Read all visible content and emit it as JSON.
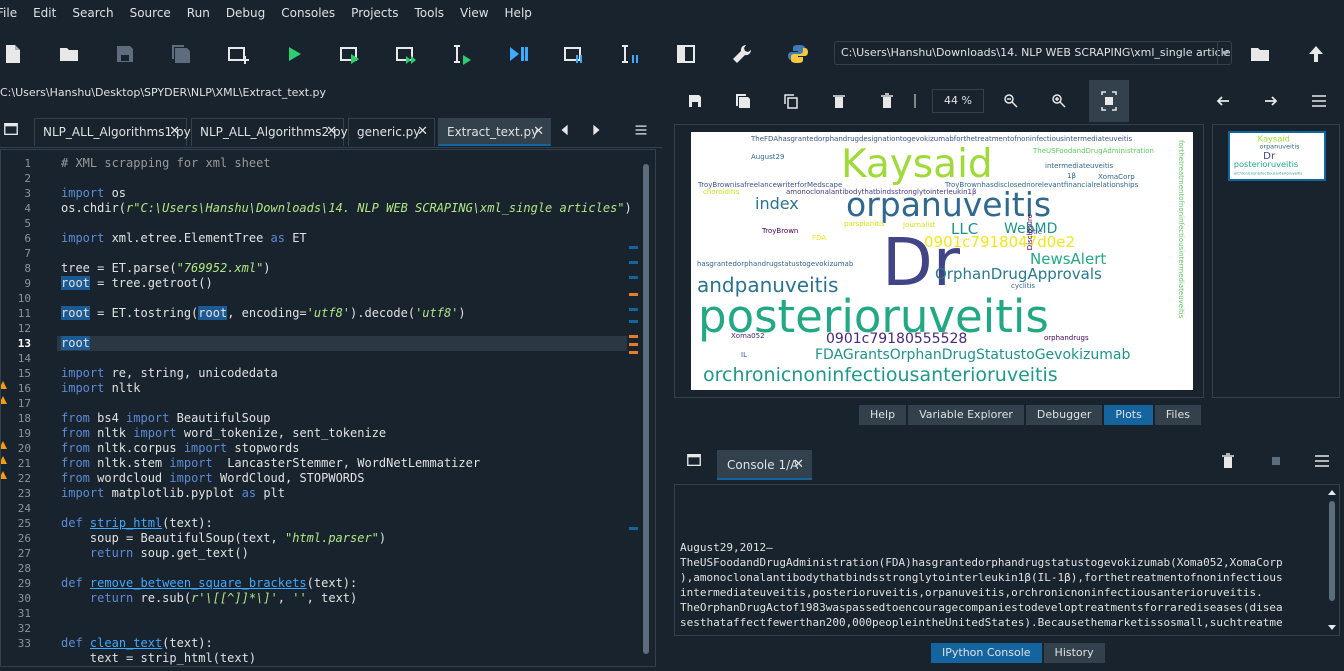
{
  "menu": [
    "File",
    "Edit",
    "Search",
    "Source",
    "Run",
    "Debug",
    "Consoles",
    "Projects",
    "Tools",
    "View",
    "Help"
  ],
  "toolbar": {
    "working_dir": "C:\\Users\\Hanshu\\Downloads\\14. NLP WEB SCRAPING\\xml_single articles"
  },
  "editor": {
    "file_path": "C:\\Users\\Hanshu\\Desktop\\SPYDER\\NLP\\XML\\Extract_text.py",
    "tabs": [
      {
        "label": "NLP_ALL_Algorithms1.py"
      },
      {
        "label": "NLP_ALL_Algorithms2.py"
      },
      {
        "label": "generic.py"
      },
      {
        "label": "Extract_text.py"
      }
    ],
    "line_numbers": [
      "1",
      "2",
      "3",
      "4",
      "5",
      "6",
      "7",
      "8",
      "9",
      "10",
      "11",
      "12",
      "13",
      "14",
      "15",
      "16",
      "17",
      "18",
      "19",
      "20",
      "21",
      "22",
      "23",
      "24",
      "25",
      "26",
      "27",
      "28",
      "29",
      "30",
      "31",
      "32",
      "33"
    ],
    "current_line": "13"
  },
  "plots": {
    "zoom": "44 %",
    "wordcloud_words": {
      "w1": "Kaysaid",
      "w2": "orpanuveitis",
      "w3": "Dr",
      "w4": "posterioruveitis",
      "w5": "andpanuveitis",
      "w6": "orchronicnoninfectiousanterioruveitis",
      "w7": "FDAGrantsOrphanDrugStatustoGevokizumab",
      "w8": "0901c7918047d0e2",
      "w9": "0901c79180555528",
      "w10": "OrphanDrugApprovals",
      "w11": "NewsAlert",
      "w12": "WebMD",
      "w13": "index",
      "w14": "LLC",
      "w15": "TheFDAhasgrantedorphandrugdesignationtogevokizumabforthetreatmentofnoninfectiousintermediateuveitis",
      "w16": "TheUSFoodandDrugAdministration",
      "w17": "August29",
      "w18": "intermediateuveitis",
      "w19": "TroyBrownisafreelancewriterforMedscape",
      "w20": "choroiditis",
      "w21": "amonoclonalantibodythatbindsstronglytointerleukin1β",
      "w22": "TroyBrownhasdisclosednorelevantfinancialrelationships",
      "w23": "XomaCorp",
      "w24": "1β",
      "w25": "TroyBrown",
      "w26": "FDA",
      "w27": "parsplanitis",
      "w28": "Journalist",
      "w29": "Title",
      "w30": "Disclosure",
      "w31": "hasgrantedorphandrugstatustogevokizumab",
      "w32": "cyclitis",
      "w33": "orphandrugs",
      "w34": "Xoma052",
      "w35": "IL",
      "w36": "forthetreatmentofnoninfectiousintermediateuveitis"
    },
    "tabs": [
      "Help",
      "Variable Explorer",
      "Debugger",
      "Plots",
      "Files"
    ],
    "active_tab": "Plots"
  },
  "console": {
    "tab_label": "Console 1/A",
    "lines": [
      "August29,2012—",
      "TheUSFoodandDrugAdministration(FDA)hasgrantedorphandrugstatustogevokizumab(Xoma052,XomaCorp",
      "),amonoclonalantibodythatbindsstronglytointerleukin1β(IL-1β),forthetreatmentofnoninfectious",
      "intermediateuveitis,posterioruveitis,orpanuveitis,orchronicnoninfectiousanterioruveitis.",
      "TheOrphanDrugActof1983waspassedtoencouragecompaniestodeveloptreatmentsforrarediseases(disea",
      "sesthataffectfewerthan200,000peopleintheUnitedStates).Becausethemarketissosmall,suchtreatme"
    ],
    "tabs": [
      "IPython Console",
      "History"
    ],
    "active_tab": "IPython Console"
  },
  "colors": {
    "background": "#19232d",
    "accent": "#1464a0",
    "border": "#32414b"
  }
}
